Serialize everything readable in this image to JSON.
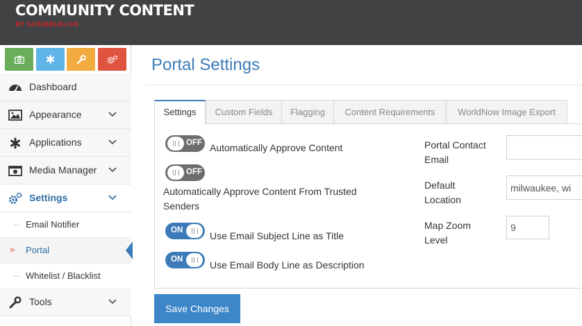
{
  "header": {
    "brand": "COMMUNITY CONTENT",
    "brand_sub": "BY SCRIBBLELIVE",
    "bg_color": "#414244",
    "sub_color": "#c0272d"
  },
  "quick_actions": [
    {
      "icon": "camera-icon",
      "color": "#6aae5b"
    },
    {
      "icon": "asterisk-icon",
      "color": "#5fb4e8"
    },
    {
      "icon": "wrench-icon",
      "color": "#f1ab3f"
    },
    {
      "icon": "gears-icon",
      "color": "#e0533f"
    }
  ],
  "sidebar": {
    "items": [
      {
        "label": "Dashboard",
        "icon": "dashboard-icon"
      },
      {
        "label": "Appearance",
        "icon": "image-icon"
      },
      {
        "label": "Applications",
        "icon": "asterisk-icon"
      },
      {
        "label": "Media Manager",
        "icon": "media-icon"
      },
      {
        "label": "Settings",
        "icon": "gears-icon"
      },
      {
        "label": "Tools",
        "icon": "wrench-icon"
      }
    ],
    "sub_items": [
      {
        "label": "Email Notifier"
      },
      {
        "label": "Portal"
      },
      {
        "label": "Whitelist / Blacklist"
      }
    ]
  },
  "page": {
    "title": "Portal Settings"
  },
  "tabs": [
    {
      "label": "Settings"
    },
    {
      "label": "Custom Fields"
    },
    {
      "label": "Flagging"
    },
    {
      "label": "Content Requirements"
    },
    {
      "label": "WorldNow Image Export"
    }
  ],
  "options": [
    {
      "state": "OFF",
      "label": "Automatically Approve Content"
    },
    {
      "state": "OFF",
      "label_line1": "Automatically Approve Content From Trusted",
      "label_line2": "Senders"
    },
    {
      "state": "ON",
      "label": "Use Email Subject Line as Title"
    },
    {
      "state": "ON",
      "label": "Use Email Body Line as Description"
    }
  ],
  "fields": {
    "contact_email": {
      "label_line1": "Portal Contact",
      "label_line2": "Email",
      "value": ""
    },
    "default_location": {
      "label_line1": "Default",
      "label_line2": "Location",
      "value": "milwaukee, wi"
    },
    "map_zoom": {
      "label_line1": "Map Zoom",
      "label_line2": "Level",
      "value": "9"
    }
  },
  "actions": {
    "save_label": "Save Changes"
  },
  "colors": {
    "accent": "#3d7bb8",
    "toggle_off": "#6d6d6d",
    "save_button": "#3d87c9"
  }
}
